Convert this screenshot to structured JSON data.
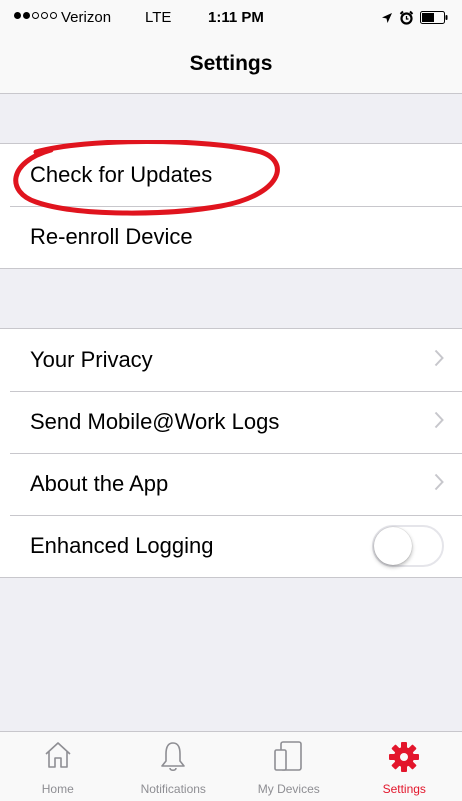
{
  "status_bar": {
    "carrier": "Verizon",
    "network": "LTE",
    "time": "1:11 PM",
    "signal_bars_filled": 2,
    "signal_bars_total": 5
  },
  "nav": {
    "title": "Settings"
  },
  "groups": [
    {
      "rows": [
        {
          "label": "Check for Updates"
        },
        {
          "label": "Re-enroll Device"
        }
      ]
    },
    {
      "rows": [
        {
          "label": "Your Privacy",
          "accessory": "chevron-right-icon"
        },
        {
          "label": "Send Mobile@Work Logs",
          "accessory": "chevron-right-icon"
        },
        {
          "label": "About the App",
          "accessory": "chevron-right-icon"
        },
        {
          "label": "Enhanced Logging",
          "accessory": "toggle",
          "toggle_on": false
        }
      ]
    }
  ],
  "tabs": [
    {
      "label": "Home",
      "icon": "home-icon",
      "active": false
    },
    {
      "label": "Notifications",
      "icon": "bell-icon",
      "active": false
    },
    {
      "label": "My Devices",
      "icon": "devices-icon",
      "active": false
    },
    {
      "label": "Settings",
      "icon": "gear-icon",
      "active": true
    }
  ],
  "colors": {
    "accent": "#e3162c",
    "annotation": "#e0141e",
    "inactive_tab": "#8e8e93",
    "background": "#efeff4"
  }
}
